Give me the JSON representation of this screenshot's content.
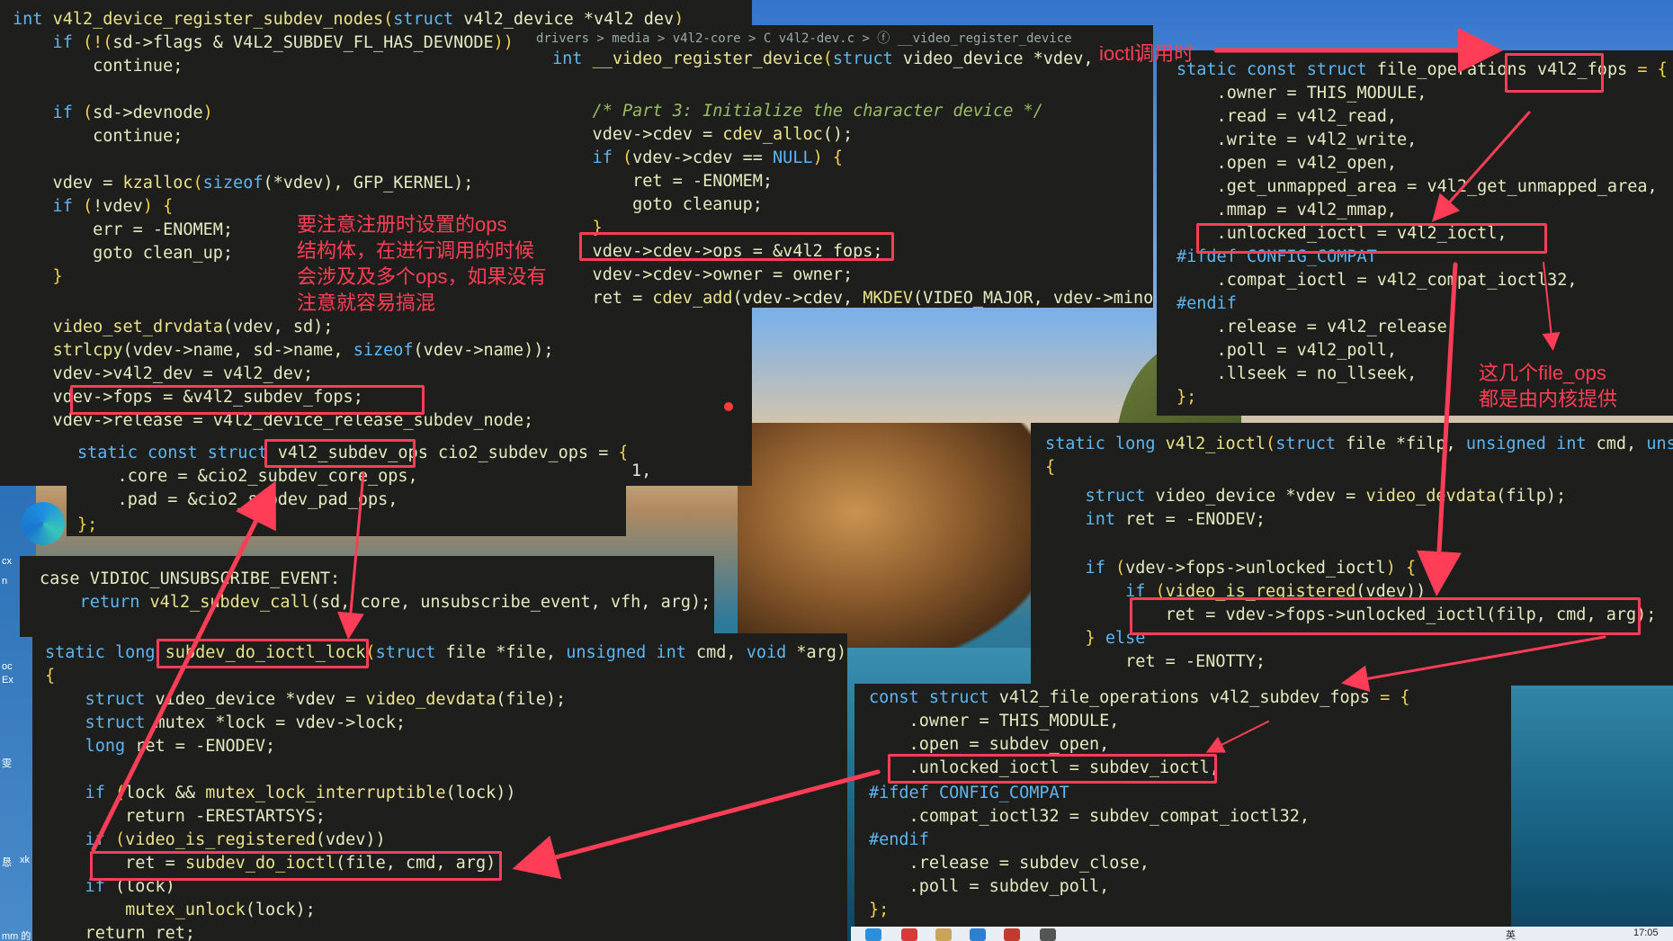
{
  "annotations": {
    "ioctl_call": "ioctl调用时",
    "ops_warning": "要注意注册时设置的ops\n结构体，在进行调用的时候\n会涉及及多个ops，如果没有\n注意就容易搞混",
    "fileops_kernel": "这几个file_ops\n都是由内核提供"
  },
  "breadcrumb": "drivers > media > v4l2-core > C v4l2-dev.c > ⓕ __video_register_device",
  "desktop": {
    "edge_labels": [
      "cx",
      "n",
      "oc",
      "Ex",
      "雯",
      "恳",
      "xk",
      "mm 的"
    ]
  },
  "taskbar": {
    "ime": "英",
    "time": "17:05"
  },
  "panels": {
    "register_subdev_nodes": [
      [
        [
          "int ",
          "kw"
        ],
        [
          "v4l2_device_register_subdev_nodes",
          "fn"
        ],
        [
          "(",
          "pu"
        ],
        [
          "struct ",
          "kw"
        ],
        [
          "v4l2_device *v4l2_dev",
          "nu"
        ],
        [
          ")",
          "pu"
        ]
      ],
      [
        [
          "    if ",
          "kw"
        ],
        [
          "(!(",
          "pu"
        ],
        [
          "sd->flags & V4L2_SUBDEV_FL_HAS_DEVNODE",
          "nu"
        ],
        [
          "))",
          "pu"
        ]
      ],
      [
        [
          "        continue;",
          "nu"
        ]
      ],
      [
        [
          "",
          ""
        ]
      ],
      [
        [
          "    if ",
          "kw"
        ],
        [
          "(",
          "pu"
        ],
        [
          "sd->devnode",
          "nu"
        ],
        [
          ")",
          "pu"
        ]
      ],
      [
        [
          "        continue;",
          "nu"
        ]
      ],
      [
        [
          "",
          ""
        ]
      ],
      [
        [
          "    vdev = ",
          "nu"
        ],
        [
          "kzalloc",
          "fn"
        ],
        [
          "(",
          "pu"
        ],
        [
          "sizeof",
          "kw"
        ],
        [
          "(*vdev), GFP_KERNEL);",
          "nu"
        ]
      ],
      [
        [
          "    if ",
          "kw"
        ],
        [
          "(",
          "pu"
        ],
        [
          "!vdev",
          "nu"
        ],
        [
          ") {",
          "pu"
        ]
      ],
      [
        [
          "        err = -ENOMEM;",
          "nu"
        ]
      ],
      [
        [
          "        goto clean_up;",
          "nu"
        ]
      ],
      [
        [
          "    }",
          "pu"
        ]
      ],
      [
        [
          "",
          ""
        ]
      ],
      [
        [
          "    ",
          "nu"
        ],
        [
          "video_set_drvdata",
          "fn"
        ],
        [
          "(vdev, sd);",
          "nu"
        ]
      ],
      [
        [
          "    ",
          "nu"
        ],
        [
          "strlcpy",
          "fn"
        ],
        [
          "(vdev->name, sd->name, ",
          "nu"
        ],
        [
          "sizeof",
          "kw"
        ],
        [
          "(vdev->name));",
          "nu"
        ]
      ],
      [
        [
          "    vdev->v4l2_dev = v4l2_dev;",
          "nu"
        ]
      ],
      [
        [
          "    vdev->fops = &v4l2_subdev_fops;",
          "nu"
        ]
      ],
      [
        [
          "    vdev->release = v4l2_device_release_subdev_node;",
          "nu"
        ]
      ]
    ],
    "video_register_device": [
      [
        [
          "int ",
          "kw"
        ],
        [
          "__video_register_device",
          "fn"
        ],
        [
          "(",
          "pu"
        ],
        [
          "struct ",
          "kw"
        ],
        [
          "video_device *vdev,",
          "nu"
        ]
      ],
      [
        [
          "",
          ""
        ]
      ],
      [
        [
          "    /* Part 3: Initialize the character device */",
          "cm"
        ]
      ],
      [
        [
          "    vdev->cdev = ",
          "nu"
        ],
        [
          "cdev_alloc",
          "fn"
        ],
        [
          "();",
          "nu"
        ]
      ],
      [
        [
          "    if ",
          "kw"
        ],
        [
          "(",
          "pu"
        ],
        [
          "vdev->cdev == ",
          "nu"
        ],
        [
          "NULL",
          "kw"
        ],
        [
          ") {",
          "pu"
        ]
      ],
      [
        [
          "        ret = -ENOMEM;",
          "nu"
        ]
      ],
      [
        [
          "        goto cleanup;",
          "nu"
        ]
      ],
      [
        [
          "    }",
          "pu"
        ]
      ],
      [
        [
          "    vdev->cdev->ops = &v4l2_fops;",
          "nu"
        ]
      ],
      [
        [
          "    vdev->cdev->owner = owner;",
          "nu"
        ]
      ],
      [
        [
          "    ret = ",
          "nu"
        ],
        [
          "cdev_add",
          "fn"
        ],
        [
          "(vdev->cdev, ",
          "nu"
        ],
        [
          "MKDEV",
          "fn"
        ],
        [
          "(VIDEO_MAJOR, vdev->minor),",
          "nu"
        ]
      ]
    ],
    "v4l2_fops": [
      [
        [
          "static const struct ",
          "kw"
        ],
        [
          "file_operations ",
          "nu"
        ],
        [
          "v4l2_fops ",
          "nu"
        ],
        [
          "= {",
          "pu"
        ]
      ],
      [
        [
          "    .owner = THIS_MODULE,",
          "nu"
        ]
      ],
      [
        [
          "    .read = v4l2_read,",
          "nu"
        ]
      ],
      [
        [
          "    .write = v4l2_write,",
          "nu"
        ]
      ],
      [
        [
          "    .open = v4l2_open,",
          "nu"
        ]
      ],
      [
        [
          "    .get_unmapped_area = v4l2_get_unmapped_area,",
          "nu"
        ]
      ],
      [
        [
          "    .mmap = v4l2_mmap,",
          "nu"
        ]
      ],
      [
        [
          "    .unlocked_ioctl = v4l2_ioctl,",
          "nu"
        ]
      ],
      [
        [
          "#ifdef ",
          "kw"
        ],
        [
          "CONFIG_COMPAT",
          "kw"
        ]
      ],
      [
        [
          "    .compat_ioctl = v4l2_compat_ioctl32,",
          "nu"
        ]
      ],
      [
        [
          "#endif",
          "kw"
        ]
      ],
      [
        [
          "    .release = v4l2_release,",
          "nu"
        ]
      ],
      [
        [
          "    .poll = v4l2_poll,",
          "nu"
        ]
      ],
      [
        [
          "    .llseek = no_llseek,",
          "nu"
        ]
      ],
      [
        [
          "};",
          "pu"
        ]
      ]
    ],
    "subdev_ops": [
      [
        [
          "static const struct ",
          "kw"
        ],
        [
          "v4l2_subdev_ops ",
          "nu"
        ],
        [
          "cio2_subdev_ops = ",
          "nu"
        ],
        [
          "{",
          "pu"
        ]
      ],
      [
        [
          "    .core = &cio2_subdev_core_ops,",
          "nu"
        ]
      ],
      [
        [
          "    .pad = &cio2_subdev_pad_ops,",
          "nu"
        ]
      ],
      [
        [
          "};",
          "pu"
        ]
      ]
    ],
    "unsubscribe": [
      [
        [
          "case VIDIOC_UNSUBSCRIBE_EVENT:",
          "nu"
        ]
      ],
      [
        [
          "    return ",
          "kw"
        ],
        [
          "v4l2_subdev_call",
          "fn"
        ],
        [
          "(sd, core, unsubscribe_event, vfh, arg);",
          "nu"
        ]
      ]
    ],
    "do_ioctl_lock": [
      [
        [
          "static long ",
          "kw"
        ],
        [
          "subdev_do_ioctl_lock",
          "fn"
        ],
        [
          "(",
          "pu"
        ],
        [
          "struct ",
          "kw"
        ],
        [
          "file *file, ",
          "nu"
        ],
        [
          "unsigned int ",
          "kw"
        ],
        [
          "cmd, ",
          "nu"
        ],
        [
          "void ",
          "kw"
        ],
        [
          "*arg)",
          "nu"
        ]
      ],
      [
        [
          "{",
          "pu"
        ]
      ],
      [
        [
          "    struct ",
          "kw"
        ],
        [
          "video_device *vdev = ",
          "nu"
        ],
        [
          "video_devdata",
          "fn"
        ],
        [
          "(file);",
          "nu"
        ]
      ],
      [
        [
          "    struct ",
          "kw"
        ],
        [
          "mutex *lock = vdev->lock;",
          "nu"
        ]
      ],
      [
        [
          "    long ",
          "kw"
        ],
        [
          "ret = -ENODEV;",
          "nu"
        ]
      ],
      [
        [
          "",
          ""
        ]
      ],
      [
        [
          "    if ",
          "kw"
        ],
        [
          "(",
          "pu"
        ],
        [
          "lock && ",
          "nu"
        ],
        [
          "mutex_lock_interruptible",
          "fn"
        ],
        [
          "(lock))",
          "nu"
        ]
      ],
      [
        [
          "        return -ERESTARTSYS;",
          "nu"
        ]
      ],
      [
        [
          "    if ",
          "kw"
        ],
        [
          "(",
          "pu"
        ],
        [
          "video_is_registered",
          "fn"
        ],
        [
          "(vdev))",
          "nu"
        ]
      ],
      [
        [
          "        ret = ",
          "nu"
        ],
        [
          "subdev_do_ioctl",
          "fn"
        ],
        [
          "(file, cmd, arg);",
          "nu"
        ]
      ],
      [
        [
          "    if ",
          "kw"
        ],
        [
          "(lock)",
          "nu"
        ]
      ],
      [
        [
          "        ",
          "nu"
        ],
        [
          "mutex_unlock",
          "fn"
        ],
        [
          "(lock);",
          "nu"
        ]
      ],
      [
        [
          "    return ret;",
          "nu"
        ]
      ]
    ],
    "v4l2_ioctl": [
      [
        [
          "static long ",
          "kw"
        ],
        [
          "v4l2_ioctl",
          "fn"
        ],
        [
          "(",
          "pu"
        ],
        [
          "struct ",
          "kw"
        ],
        [
          "file *filp, ",
          "nu"
        ],
        [
          "unsigned int ",
          "kw"
        ],
        [
          "cmd, ",
          "nu"
        ],
        [
          "unsign",
          "kw"
        ]
      ],
      [
        [
          "{",
          "pu"
        ]
      ],
      [
        [
          "    struct ",
          "kw"
        ],
        [
          "video_device *vdev = ",
          "nu"
        ],
        [
          "video_devdata",
          "fn"
        ],
        [
          "(filp);",
          "nu"
        ]
      ],
      [
        [
          "    int ",
          "kw"
        ],
        [
          "ret = -ENODEV;",
          "nu"
        ]
      ],
      [
        [
          "",
          ""
        ]
      ],
      [
        [
          "    if ",
          "kw"
        ],
        [
          "(",
          "pu"
        ],
        [
          "vdev->fops->unlocked_ioctl",
          "nu"
        ],
        [
          ") {",
          "pu"
        ]
      ],
      [
        [
          "        if ",
          "kw"
        ],
        [
          "(",
          "pu"
        ],
        [
          "video_is_registered",
          "fn"
        ],
        [
          "(vdev))",
          "nu"
        ]
      ],
      [
        [
          "            ret = vdev->fops->unlocked_ioctl(filp, cmd, arg);",
          "nu"
        ]
      ],
      [
        [
          "    } ",
          "pu"
        ],
        [
          "else",
          "kw"
        ]
      ],
      [
        [
          "        ret = -ENOTTY;",
          "nu"
        ]
      ]
    ],
    "subdev_fops": [
      [
        [
          "const struct ",
          "kw"
        ],
        [
          "v4l2_file_operations ",
          "nu"
        ],
        [
          "v4l2_subdev_fops ",
          "nu"
        ],
        [
          "= {",
          "pu"
        ]
      ],
      [
        [
          "    .owner = THIS_MODULE,",
          "nu"
        ]
      ],
      [
        [
          "    .open = subdev_open,",
          "nu"
        ]
      ],
      [
        [
          "    .unlocked_ioctl = subdev_ioctl,",
          "nu"
        ]
      ],
      [
        [
          "#ifdef ",
          "kw"
        ],
        [
          "CONFIG_COMPAT",
          "kw"
        ]
      ],
      [
        [
          "    .compat_ioctl32 = subdev_compat_ioctl32,",
          "nu"
        ]
      ],
      [
        [
          "#endif",
          "kw"
        ]
      ],
      [
        [
          "    .release = subdev_close,",
          "nu"
        ]
      ],
      [
        [
          "    .poll = subdev_poll,",
          "nu"
        ]
      ],
      [
        [
          "};",
          "pu"
        ]
      ]
    ],
    "tail_fragment": [
      [
        [
          "1,",
          "nu"
        ]
      ]
    ]
  }
}
